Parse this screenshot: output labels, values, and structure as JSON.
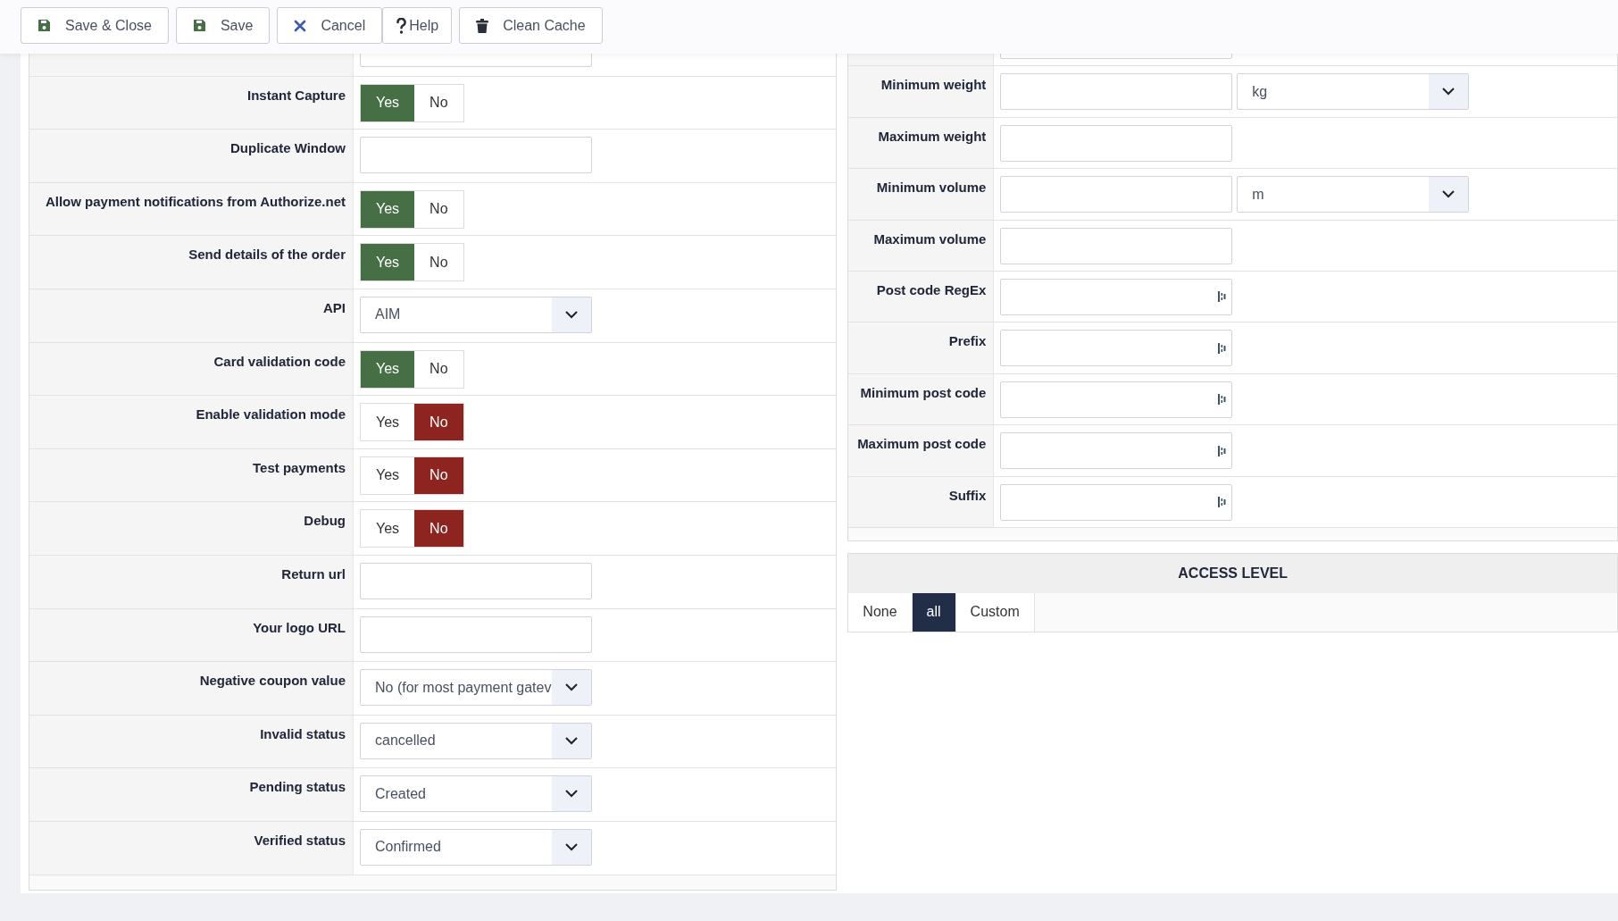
{
  "toolbar": [
    {
      "kind": "save",
      "label": "Save & Close"
    },
    {
      "kind": "save",
      "label": "Save"
    },
    {
      "kind": "cancel",
      "label": "Cancel"
    },
    {
      "kind": "help",
      "label": "Help"
    },
    {
      "kind": "trash",
      "label": "Clean Cache"
    }
  ],
  "left_fields": [
    {
      "kind": "text"
    },
    {
      "kind": "toggle",
      "label": "Instant Capture",
      "options": [
        {
          "label": "Yes",
          "selected": true
        },
        {
          "label": "No",
          "selected": false
        }
      ]
    },
    {
      "kind": "text",
      "label": "Duplicate Window"
    },
    {
      "kind": "toggle",
      "label": "Allow payment notifications from Authorize.net",
      "options": [
        {
          "label": "Yes",
          "selected": true
        },
        {
          "label": "No",
          "selected": false
        }
      ]
    },
    {
      "kind": "toggle",
      "label": "Send details of the order",
      "options": [
        {
          "label": "Yes",
          "selected": true
        },
        {
          "label": "No",
          "selected": false
        }
      ]
    },
    {
      "kind": "select",
      "label": "API",
      "value": "AIM"
    },
    {
      "kind": "toggle",
      "label": "Card validation code",
      "options": [
        {
          "label": "Yes",
          "selected": true
        },
        {
          "label": "No",
          "selected": false
        }
      ]
    },
    {
      "kind": "toggle",
      "label": "Enable validation mode",
      "options": [
        {
          "label": "Yes",
          "selected": false
        },
        {
          "label": "No",
          "selected": true
        }
      ]
    },
    {
      "kind": "toggle",
      "label": "Test payments",
      "options": [
        {
          "label": "Yes",
          "selected": false
        },
        {
          "label": "No",
          "selected": true
        }
      ]
    },
    {
      "kind": "toggle",
      "label": "Debug",
      "options": [
        {
          "label": "Yes",
          "selected": false
        },
        {
          "label": "No",
          "selected": true
        }
      ]
    },
    {
      "kind": "text",
      "label": "Return url"
    },
    {
      "kind": "text",
      "label": "Your logo URL"
    },
    {
      "kind": "select",
      "label": "Negative coupon value",
      "value": "No (for most payment gatev"
    },
    {
      "kind": "select",
      "label": "Invalid status",
      "value": "cancelled"
    },
    {
      "kind": "select",
      "label": "Pending status",
      "value": "Created"
    },
    {
      "kind": "select",
      "label": "Verified status",
      "value": "Confirmed"
    }
  ],
  "right_fields": [
    {
      "kind": "text"
    },
    {
      "kind": "text_unit",
      "label": "Minimum weight",
      "unit": "kg"
    },
    {
      "kind": "text",
      "label": "Maximum weight"
    },
    {
      "kind": "text_unit",
      "label": "Minimum volume",
      "unit": "m"
    },
    {
      "kind": "text",
      "label": "Maximum volume"
    },
    {
      "kind": "text_icon",
      "label": "Post code RegEx"
    },
    {
      "kind": "text_icon",
      "label": "Prefix"
    },
    {
      "kind": "text_icon",
      "label": "Minimum post code"
    },
    {
      "kind": "text_icon",
      "label": "Maximum post code"
    },
    {
      "kind": "text_icon",
      "label": "Suffix"
    }
  ],
  "access_level": {
    "title": "ACCESS LEVEL",
    "options": [
      {
        "label": "None",
        "selected": false
      },
      {
        "label": "all",
        "selected": true
      },
      {
        "label": "Custom",
        "selected": false
      }
    ]
  }
}
